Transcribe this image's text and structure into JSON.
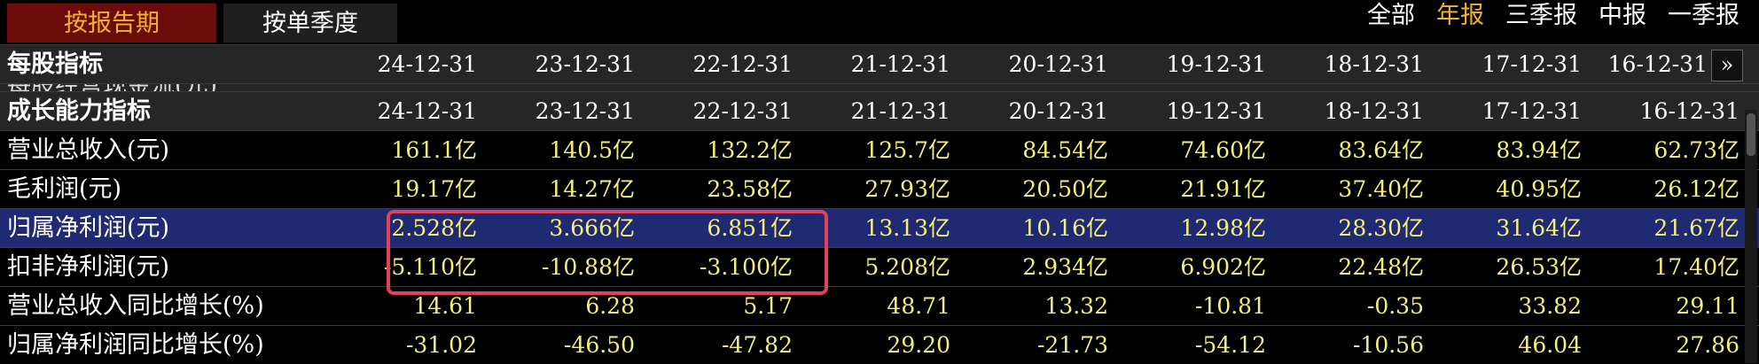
{
  "tabs": [
    {
      "label": "按报告期",
      "active": true
    },
    {
      "label": "按单季度",
      "active": false
    }
  ],
  "filters": [
    {
      "label": "全部",
      "active": false
    },
    {
      "label": "年报",
      "active": true
    },
    {
      "label": "三季报",
      "active": false
    },
    {
      "label": "中报",
      "active": false
    },
    {
      "label": "一季报",
      "active": false
    }
  ],
  "more_button": "»",
  "per_share_header": {
    "label": "每股指标",
    "dates": [
      "24-12-31",
      "23-12-31",
      "22-12-31",
      "21-12-31",
      "20-12-31",
      "19-12-31",
      "18-12-31",
      "17-12-31",
      "16-12-31"
    ]
  },
  "clipped_row_label": "每股经营现金流(元)",
  "growth_header": {
    "label": "成长能力指标",
    "dates": [
      "24-12-31",
      "23-12-31",
      "22-12-31",
      "21-12-31",
      "20-12-31",
      "19-12-31",
      "18-12-31",
      "17-12-31",
      "16-12-31"
    ]
  },
  "rows": [
    {
      "label": "营业总收入(元)",
      "values": [
        "161.1亿",
        "140.5亿",
        "132.2亿",
        "125.7亿",
        "84.54亿",
        "74.60亿",
        "83.64亿",
        "83.94亿",
        "62.73亿"
      ]
    },
    {
      "label": "毛利润(元)",
      "values": [
        "19.17亿",
        "14.27亿",
        "23.58亿",
        "27.93亿",
        "20.50亿",
        "21.91亿",
        "37.40亿",
        "40.95亿",
        "26.12亿"
      ]
    },
    {
      "label": "归属净利润(元)",
      "values": [
        "2.528亿",
        "3.666亿",
        "6.851亿",
        "13.13亿",
        "10.16亿",
        "12.98亿",
        "28.30亿",
        "31.64亿",
        "21.67亿"
      ]
    },
    {
      "label": "扣非净利润(元)",
      "values": [
        "-5.110亿",
        "-10.88亿",
        "-3.100亿",
        "5.208亿",
        "2.934亿",
        "6.902亿",
        "22.48亿",
        "26.53亿",
        "17.40亿"
      ]
    },
    {
      "label": "营业总收入同比增长(%)",
      "values": [
        "14.61",
        "6.28",
        "5.17",
        "48.71",
        "13.32",
        "-10.81",
        "-0.35",
        "33.82",
        "29.11"
      ]
    },
    {
      "label": "归属净利润同比增长(%)",
      "values": [
        "-31.02",
        "-46.50",
        "-47.82",
        "29.20",
        "-21.73",
        "-54.12",
        "-10.56",
        "46.04",
        "27.86"
      ]
    }
  ],
  "colors": {
    "accent": "#f2b22d",
    "value": "#f5f07a",
    "highlight_row": "#202a73",
    "annotation": "#e0425a"
  }
}
